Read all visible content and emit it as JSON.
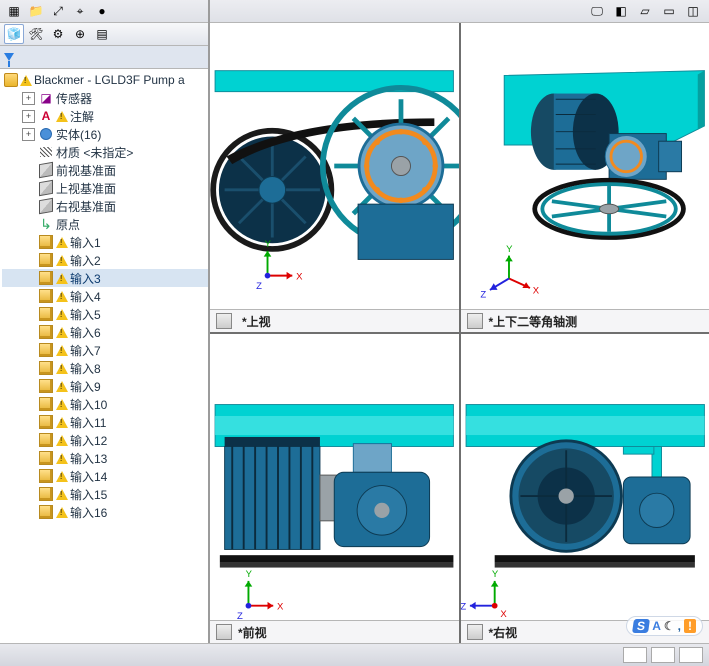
{
  "toolbar": {
    "left_icons": [
      "grid-view",
      "folder",
      "expand",
      "target",
      "ball"
    ],
    "right_icons": [
      "display-state",
      "shaded",
      "wire",
      "hidden",
      "section"
    ]
  },
  "tree_tabs": [
    "feature-manager",
    "property-manager",
    "config-manager",
    "dim-x",
    "display-manager"
  ],
  "root": {
    "label": "Blackmer - LGLD3F Pump a",
    "warn": true
  },
  "nodes": [
    {
      "type": "sensor",
      "label": "传感器",
      "expander": "+",
      "warn": false
    },
    {
      "type": "note",
      "label": "注解",
      "expander": "+",
      "warn": true
    },
    {
      "type": "solids",
      "label": "实体(16)",
      "expander": "+",
      "warn": false
    },
    {
      "type": "material",
      "label": "材质 <未指定>",
      "expander": "",
      "warn": false
    },
    {
      "type": "plane",
      "label": "前视基准面",
      "expander": "",
      "warn": false
    },
    {
      "type": "plane",
      "label": "上视基准面",
      "expander": "",
      "warn": false
    },
    {
      "type": "plane",
      "label": "右视基准面",
      "expander": "",
      "warn": false
    },
    {
      "type": "origin",
      "label": "原点",
      "expander": "",
      "warn": false
    },
    {
      "type": "body",
      "label": "输入1",
      "expander": "",
      "warn": true
    },
    {
      "type": "body",
      "label": "输入2",
      "expander": "",
      "warn": true
    },
    {
      "type": "body",
      "label": "输入3",
      "expander": "",
      "warn": true,
      "selected": true
    },
    {
      "type": "body",
      "label": "输入4",
      "expander": "",
      "warn": true
    },
    {
      "type": "body",
      "label": "输入5",
      "expander": "",
      "warn": true
    },
    {
      "type": "body",
      "label": "输入6",
      "expander": "",
      "warn": true
    },
    {
      "type": "body",
      "label": "输入7",
      "expander": "",
      "warn": true
    },
    {
      "type": "body",
      "label": "输入8",
      "expander": "",
      "warn": true
    },
    {
      "type": "body",
      "label": "输入9",
      "expander": "",
      "warn": true
    },
    {
      "type": "body",
      "label": "输入10",
      "expander": "",
      "warn": true
    },
    {
      "type": "body",
      "label": "输入11",
      "expander": "",
      "warn": true
    },
    {
      "type": "body",
      "label": "输入12",
      "expander": "",
      "warn": true
    },
    {
      "type": "body",
      "label": "输入13",
      "expander": "",
      "warn": true
    },
    {
      "type": "body",
      "label": "输入14",
      "expander": "",
      "warn": true
    },
    {
      "type": "body",
      "label": "输入15",
      "expander": "",
      "warn": true
    },
    {
      "type": "body",
      "label": "输入16",
      "expander": "",
      "warn": true
    }
  ],
  "views": {
    "tl": {
      "name": "*上视"
    },
    "tr": {
      "name": "*上下二等角轴测"
    },
    "bl": {
      "name": "*前视"
    },
    "br": {
      "name": "*右视"
    }
  },
  "triad": {
    "x": "X",
    "y": "Y",
    "z": "Z"
  },
  "colors": {
    "frame": "#00d2d2",
    "frame_dark": "#0f8a99",
    "motor_dark": "#164a64",
    "motor_mid": "#1d6d97",
    "motor_light": "#6ea5c7",
    "ring_orange": "#f28a1e",
    "steel": "#9aa2a7"
  },
  "badge": {
    "s": "S",
    "a": "A",
    "moon": "☾",
    "comma": ",",
    "excl": "!"
  }
}
